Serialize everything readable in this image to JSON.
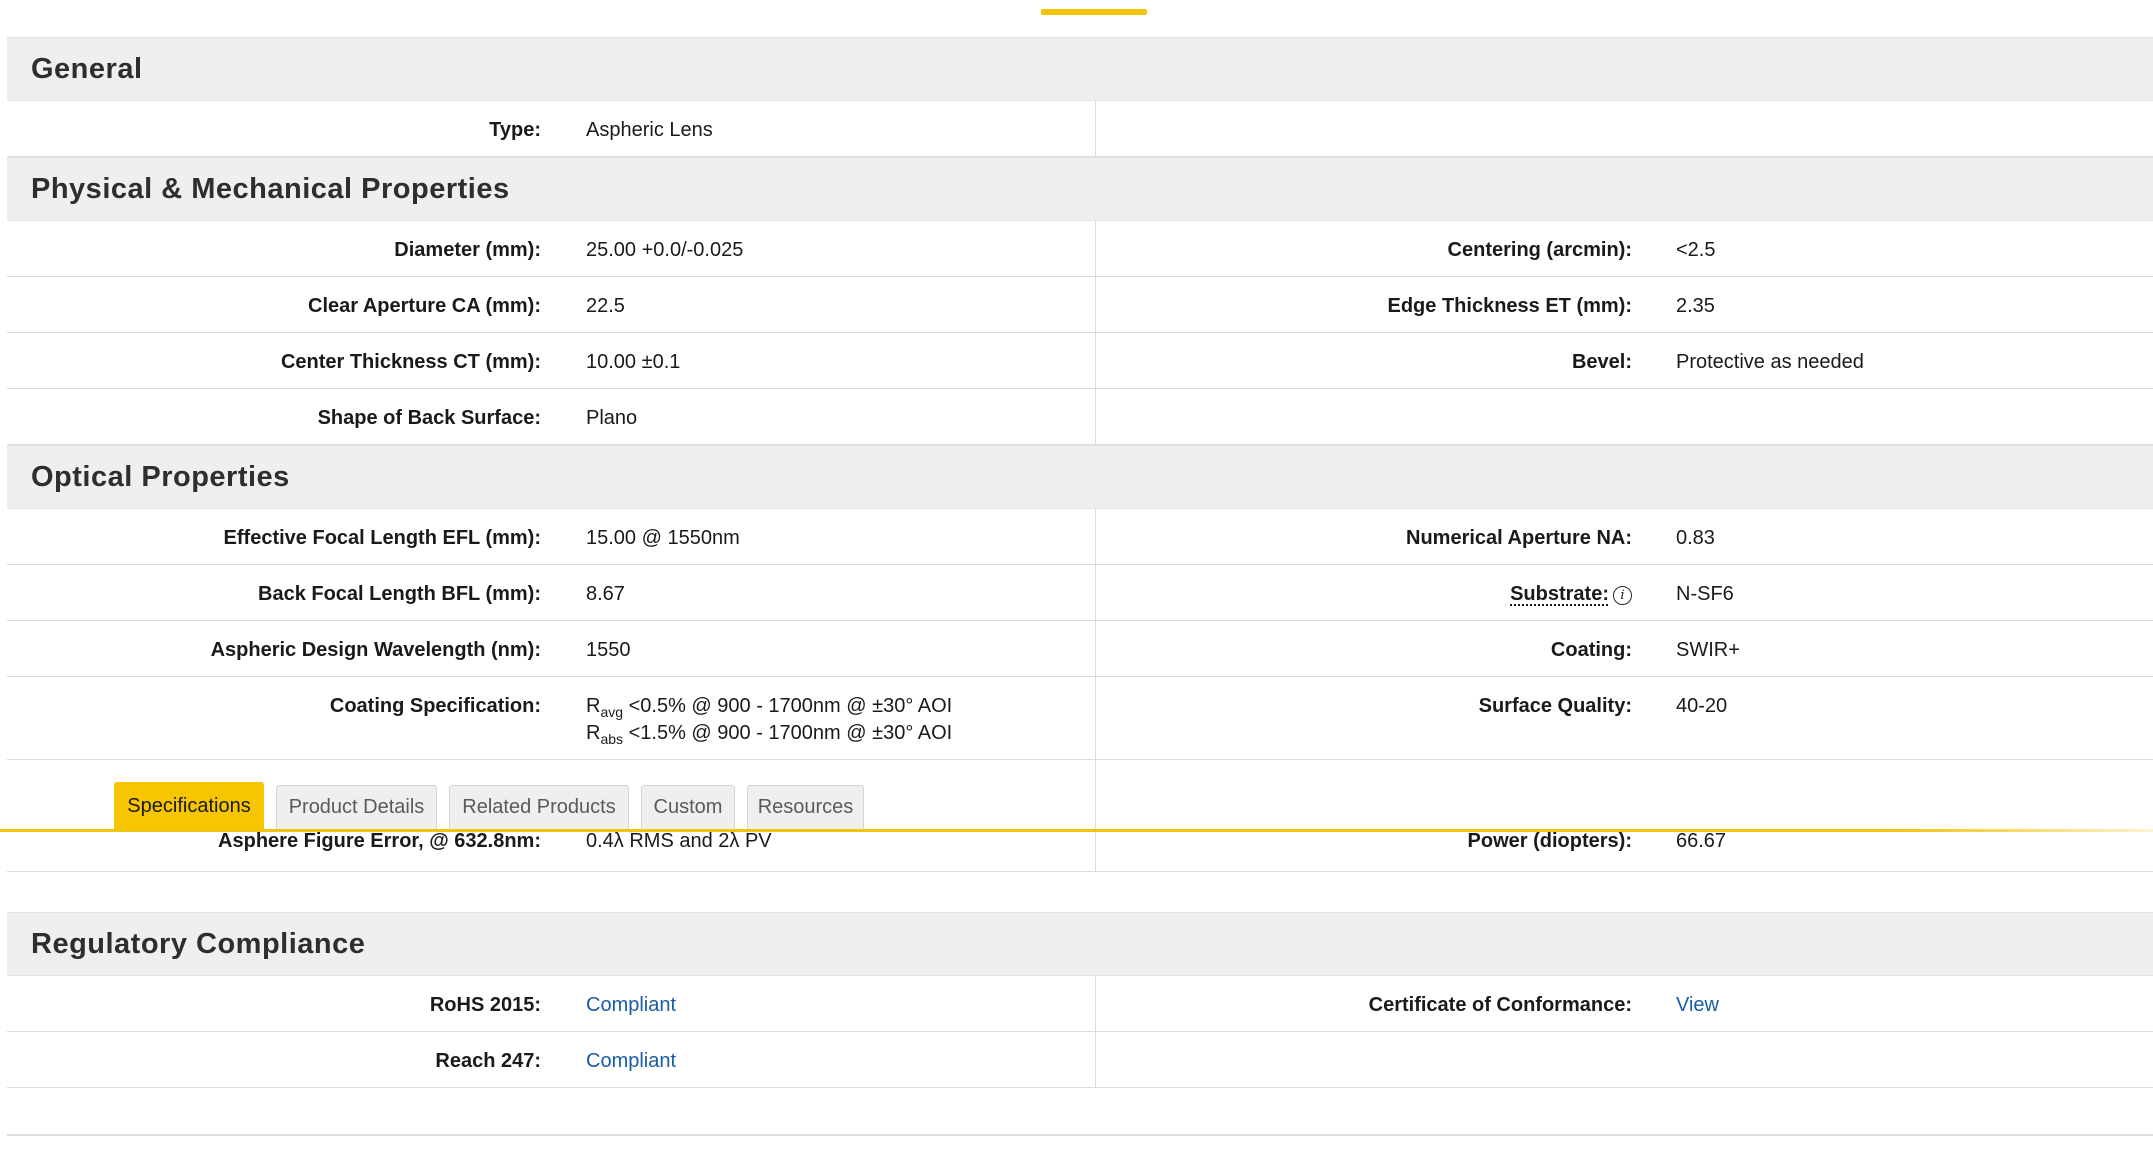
{
  "general": {
    "title": "General",
    "rows": [
      {
        "left_label": "Type:",
        "left_value": "Aspheric Lens"
      }
    ]
  },
  "physical": {
    "title": "Physical & Mechanical Properties",
    "rows": [
      {
        "left_label": "Diameter (mm):",
        "left_value": "25.00 +0.0/-0.025",
        "right_label": "Centering (arcmin):",
        "right_value": "<2.5"
      },
      {
        "left_label": "Clear Aperture CA (mm):",
        "left_value": "22.5",
        "right_label": "Edge Thickness ET (mm):",
        "right_value": "2.35"
      },
      {
        "left_label": "Center Thickness CT (mm):",
        "left_value": "10.00 ±0.1",
        "right_label": "Bevel:",
        "right_value": "Protective as needed"
      },
      {
        "left_label": "Shape of Back Surface:",
        "left_value": "Plano"
      }
    ]
  },
  "optical": {
    "title": "Optical Properties",
    "rows": [
      {
        "left_label": "Effective Focal Length EFL (mm):",
        "left_value": "15.00 @ 1550nm",
        "right_label": "Numerical Aperture NA:",
        "right_value": "0.83"
      },
      {
        "left_label": "Back Focal Length BFL (mm):",
        "left_value": "8.67",
        "right_label": "Substrate:",
        "right_value": "N-SF6"
      },
      {
        "left_label": "Aspheric Design Wavelength (nm):",
        "left_value": "1550",
        "right_label": "Coating:",
        "right_value": "SWIR+"
      },
      {
        "left_label": "Coating Specification:",
        "right_label": "Surface Quality:",
        "right_value": "40-20"
      },
      {
        "left_label": "Asphere Figure Error, @ 632.8nm:",
        "left_value": "0.4λ RMS and 2λ PV",
        "right_label": "Power (diopters):",
        "right_value": "66.67"
      }
    ],
    "coating_spec": {
      "line1_prefix": "R",
      "line1_sub": "avg",
      "line1_text": " <0.5% @ 900 - 1700nm @ ±30° AOI",
      "line2_prefix": "R",
      "line2_sub": "abs",
      "line2_text": " <1.5% @ 900 - 1700nm @ ±30° AOI"
    },
    "substrate_info_icon": "info-icon"
  },
  "tabs": [
    {
      "label": "Specifications",
      "active": true
    },
    {
      "label": "Product Details",
      "active": false
    },
    {
      "label": "Related Products",
      "active": false
    },
    {
      "label": "Custom",
      "active": false
    },
    {
      "label": "Resources",
      "active": false
    }
  ],
  "regulatory": {
    "title": "Regulatory Compliance",
    "rows": [
      {
        "left_label": "RoHS 2015:",
        "left_value": "Compliant",
        "right_label": "Certificate of Conformance:",
        "right_value": "View"
      },
      {
        "left_label": "Reach 247:",
        "left_value": "Compliant"
      }
    ]
  },
  "colors": {
    "accent": "#f7c600",
    "link": "#1a5ca6",
    "section_bg": "#efefef"
  }
}
